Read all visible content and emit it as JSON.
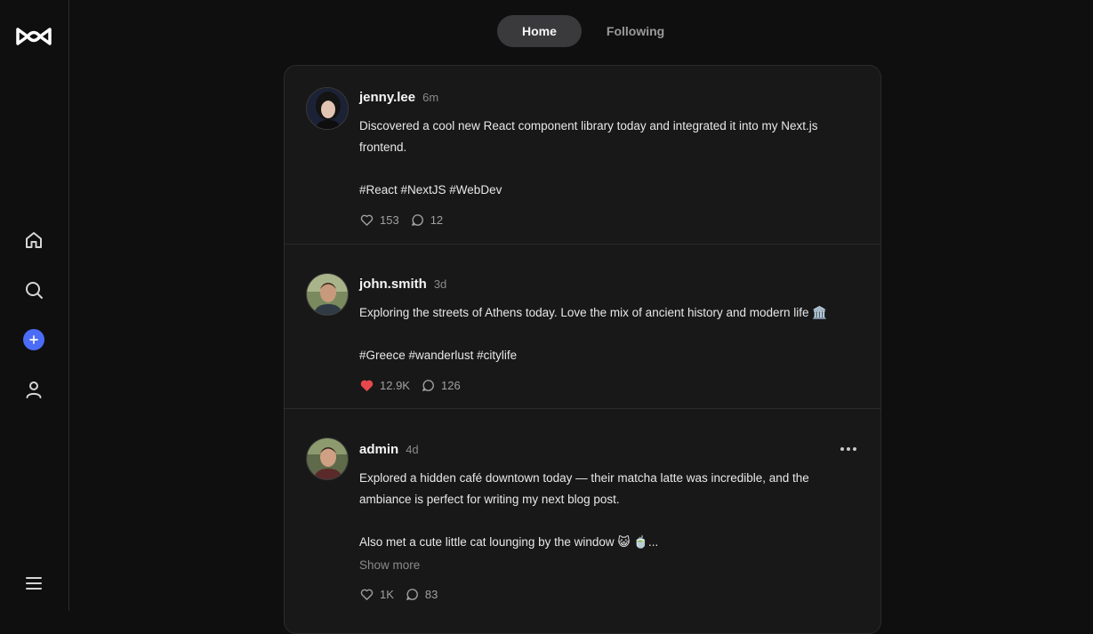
{
  "tabs": [
    {
      "label": "Home",
      "active": true
    },
    {
      "label": "Following",
      "active": false
    }
  ],
  "sidebar": {
    "icons": [
      "logo-icon",
      "home-icon",
      "search-icon",
      "plus-icon",
      "user-icon",
      "menu-icon"
    ],
    "accent": "#4a6cf7"
  },
  "posts": [
    {
      "username": "jenny.lee",
      "time": "6m",
      "text": "Discovered a cool new React component library today and integrated it into my Next.js frontend.\n\n#React #NextJS #WebDev",
      "likes": "153",
      "comments": "12",
      "liked": false
    },
    {
      "username": "john.smith",
      "time": "3d",
      "text": "Exploring the streets of Athens today. Love the mix of ancient history and modern life 🏛️\n\n#Greece #wanderlust #citylife",
      "likes": "12.9K",
      "comments": "126",
      "liked": true
    },
    {
      "username": "admin",
      "time": "4d",
      "text": "Explored a hidden café downtown today — their matcha latte was incredible, and the ambiance is perfect for writing my next blog post.\n\nAlso met a cute little cat lounging by the window 😺 🍵...",
      "show_more": "Show more",
      "likes": "1K",
      "comments": "83",
      "liked": false
    }
  ],
  "colors": {
    "like_active": "#e5484d",
    "background": "#0f0f0f",
    "card": "#181818"
  }
}
